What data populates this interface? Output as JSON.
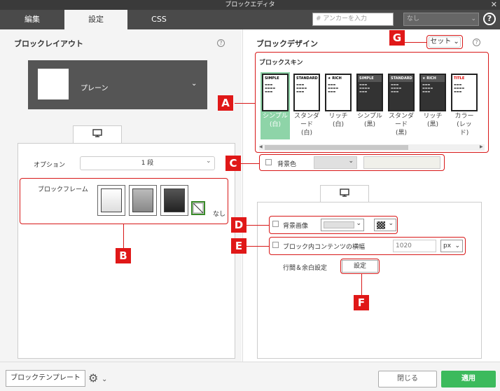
{
  "window": {
    "title": "ブロックエディタ",
    "close_glyph": "✕"
  },
  "tabs": [
    {
      "label": "編集"
    },
    {
      "label": "設定"
    },
    {
      "label": "CSS"
    }
  ],
  "header": {
    "anchor_placeholder": "# アンカーを入力",
    "nasi_value": "なし",
    "help_glyph": "?"
  },
  "layout": {
    "title": "ブロックレイアウト",
    "selected": "プレーン",
    "device_icon": "monitor-icon",
    "option_label": "オプション",
    "option_value": "1 段",
    "frame_label": "ブロックフレーム",
    "frame_none_label": "なし"
  },
  "design": {
    "title": "ブロックデザイン",
    "set_label": "セット",
    "skin_title": "ブロックスキン",
    "skins": [
      {
        "header": "SIMPLE",
        "label": "シンプル\n(白)",
        "dark": false,
        "selected": true
      },
      {
        "header": "STANDARD",
        "label": "スタンダ\nード\n(白)",
        "dark": false,
        "selected": false
      },
      {
        "header": "★ RICH",
        "label": "リッチ\n(白)",
        "dark": false,
        "selected": false
      },
      {
        "header": "SIMPLE",
        "label": "シンプル\n(黒)",
        "dark": true,
        "selected": false
      },
      {
        "header": "STANDARD",
        "label": "スタンダ\nード\n(黒)",
        "dark": true,
        "selected": false
      },
      {
        "header": "★ RICH",
        "label": "リッチ\n(黒)",
        "dark": true,
        "selected": false
      },
      {
        "header": "TITLE",
        "label": "カラー\n(レッ\nド)",
        "dark": false,
        "selected": false
      }
    ],
    "bg_color_label": "背景色",
    "bg_image_label": "背景画像",
    "content_width_label": "ブロック内コンテンツの横幅",
    "content_width_value": "1020",
    "content_width_unit": "px",
    "spacing_label": "行間＆余白設定",
    "spacing_button": "設定"
  },
  "callouts": {
    "A": "A",
    "B": "B",
    "C": "C",
    "D": "D",
    "E": "E",
    "F": "F",
    "G": "G"
  },
  "footer": {
    "template_label": "ブロックテンプレート",
    "close_label": "閉じる",
    "apply_label": "適用"
  },
  "colors": {
    "accent_green": "#3cba5c",
    "callout_red": "#e01818",
    "selection_green": "#8ed4a8"
  }
}
